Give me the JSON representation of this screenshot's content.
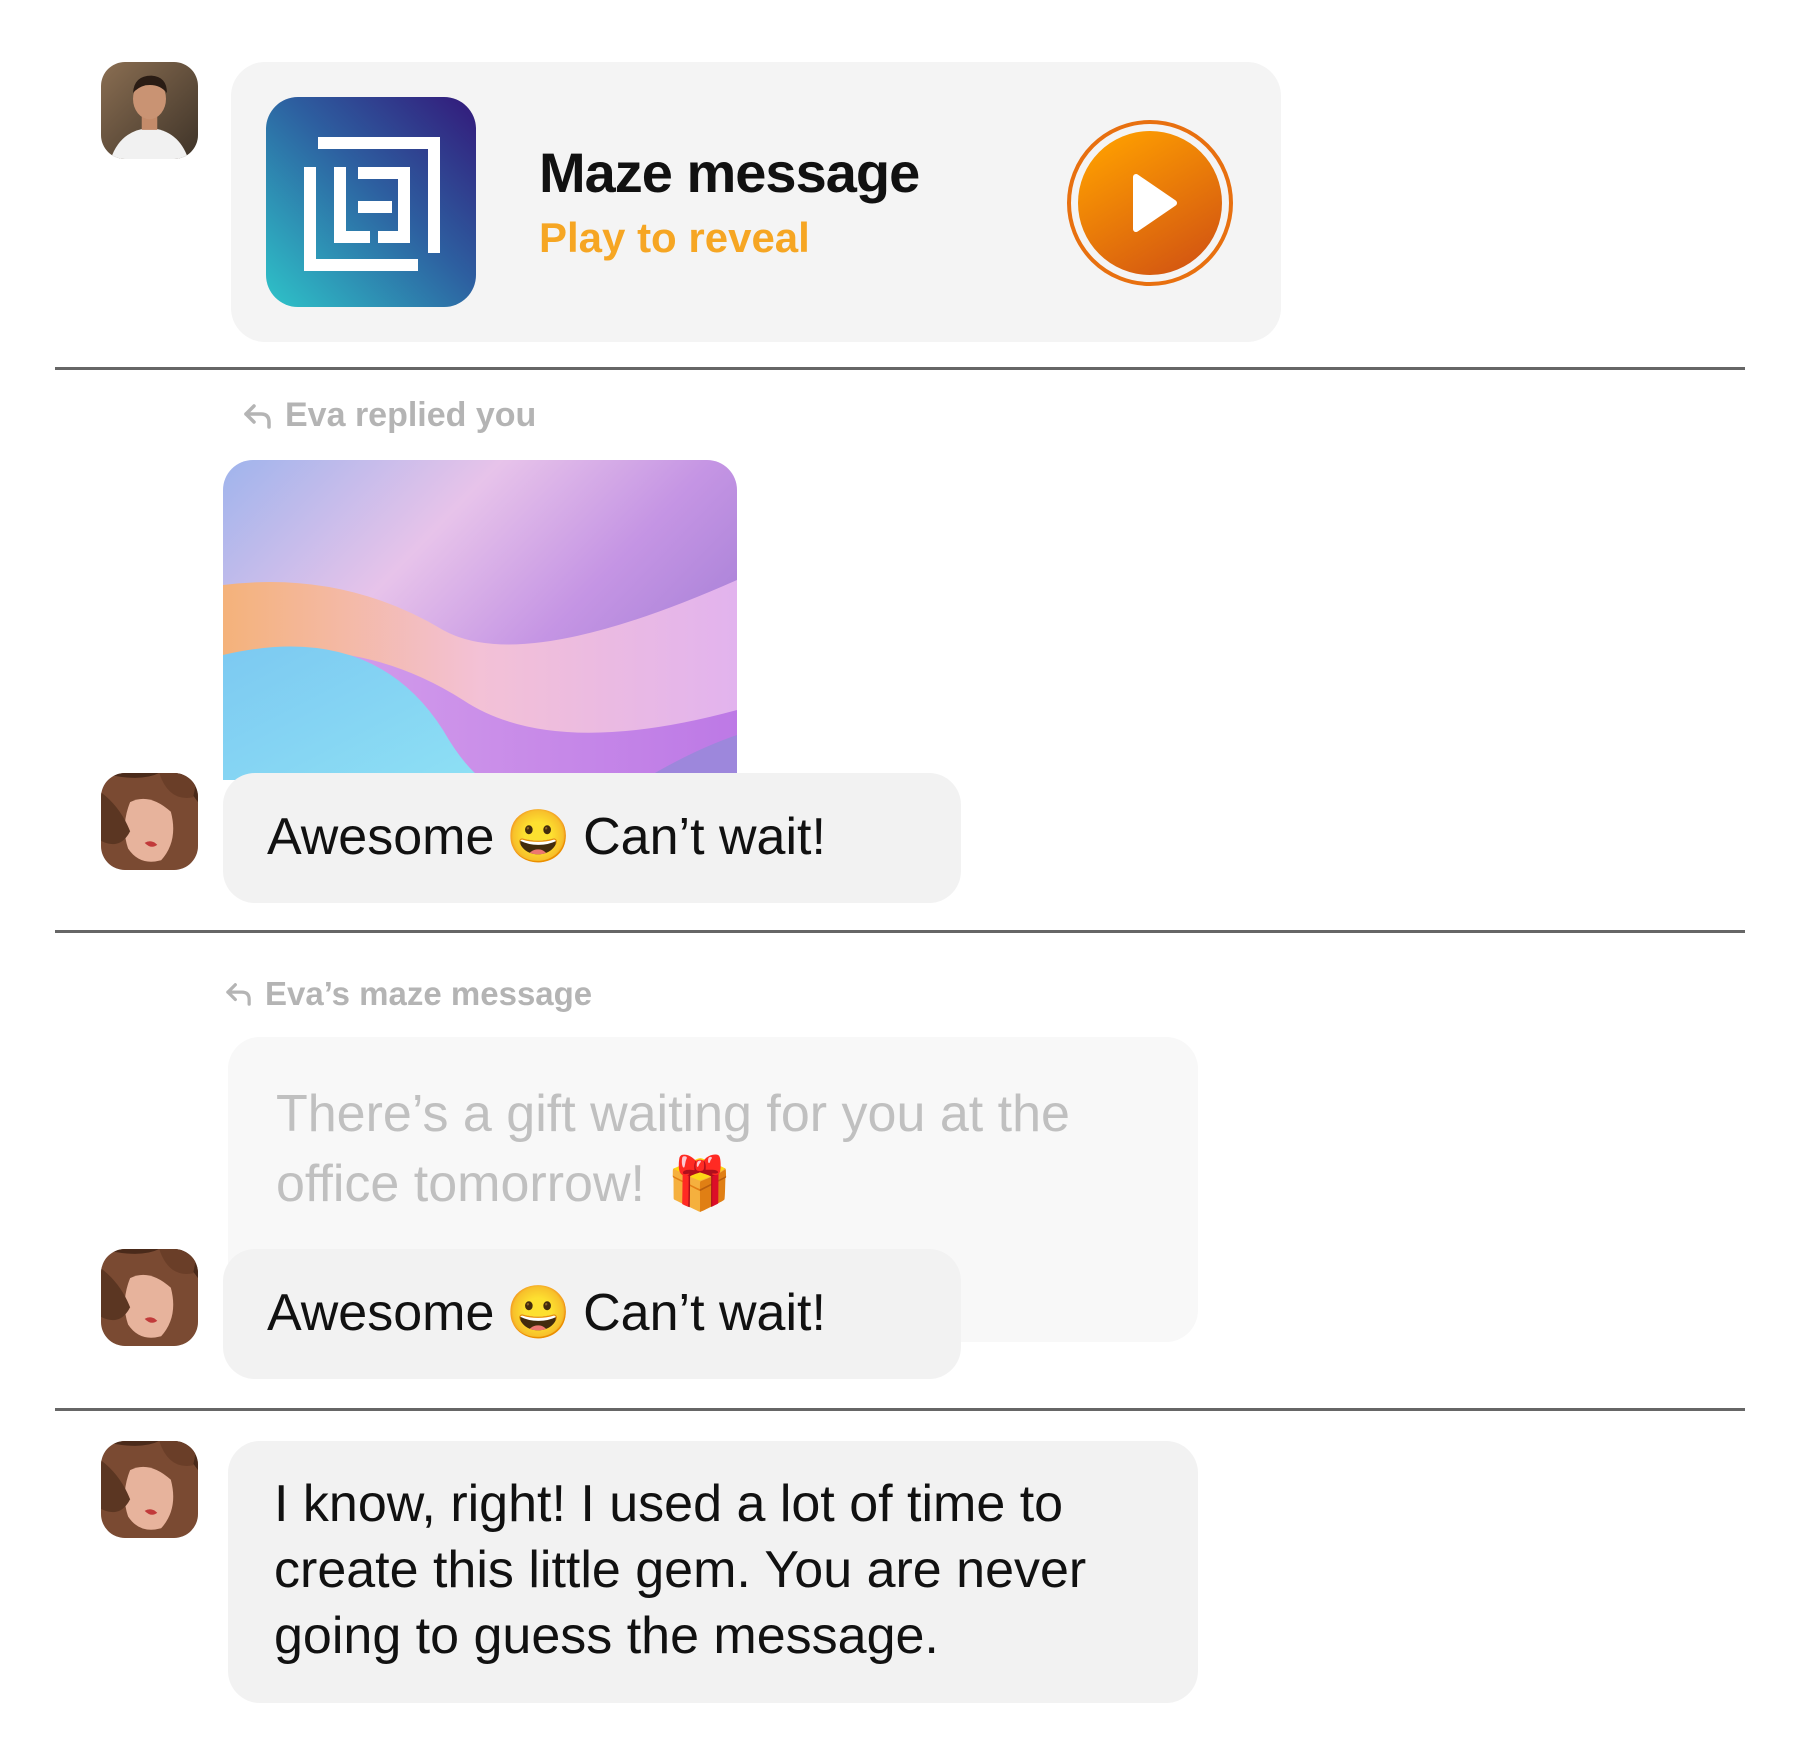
{
  "maze_card": {
    "title": "Maze message",
    "subtitle": "Play to reveal",
    "play_icon": "play-icon",
    "app_icon": "maze-logo-icon"
  },
  "reply_one": {
    "label": "Eva replied you",
    "icon": "reply-arrow-icon"
  },
  "reply_one_message": {
    "text_before": "Awesome",
    "emoji": "😀",
    "text_after": "Can’t wait!"
  },
  "reply_two": {
    "label": "Eva’s maze message",
    "icon": "reply-arrow-icon"
  },
  "quoted_message": {
    "text": "There’s a gift waiting for you at the office tomorrow!",
    "emoji": "🎁"
  },
  "reply_two_message": {
    "text_before": "Awesome",
    "emoji": "😀",
    "text_after": "Can’t wait!"
  },
  "final_message": {
    "text": "I know, right! I used a lot of time to create this little gem. You are never going to guess the message."
  },
  "colors": {
    "accent_orange": "#f6a623",
    "play_button": "#e8700f",
    "bubble": "#f2f2f2",
    "muted_text": "#b4b4b4"
  }
}
